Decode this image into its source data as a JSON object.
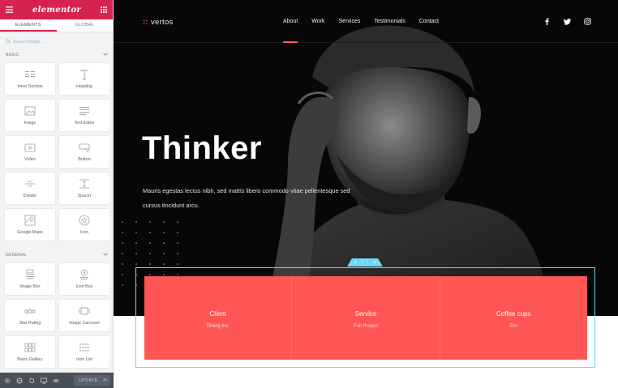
{
  "editor": {
    "logo": "elementor",
    "tabs": [
      {
        "label": "ELEMENTS"
      },
      {
        "label": "GLOBAL"
      }
    ],
    "search": {
      "placeholder": "Search Widget..."
    },
    "sections": [
      {
        "title": "BASIC",
        "widgets": [
          {
            "label": "Inner Section",
            "icon": "inner-section-icon"
          },
          {
            "label": "Heading",
            "icon": "heading-icon"
          },
          {
            "label": "Image",
            "icon": "image-icon"
          },
          {
            "label": "Text Editor",
            "icon": "text-editor-icon"
          },
          {
            "label": "Video",
            "icon": "video-icon"
          },
          {
            "label": "Button",
            "icon": "button-icon"
          },
          {
            "label": "Divider",
            "icon": "divider-icon"
          },
          {
            "label": "Spacer",
            "icon": "spacer-icon"
          },
          {
            "label": "Google Maps",
            "icon": "google-maps-icon"
          },
          {
            "label": "Icon",
            "icon": "star-icon"
          }
        ]
      },
      {
        "title": "GENERAL",
        "widgets": [
          {
            "label": "Image Box",
            "icon": "image-box-icon"
          },
          {
            "label": "Icon Box",
            "icon": "icon-box-icon"
          },
          {
            "label": "Star Rating",
            "icon": "star-rating-icon"
          },
          {
            "label": "Image Carousel",
            "icon": "image-carousel-icon"
          },
          {
            "label": "Basic Gallery",
            "icon": "basic-gallery-icon"
          },
          {
            "label": "Icon List",
            "icon": "icon-list-icon"
          }
        ]
      }
    ],
    "footer": {
      "update_label": "UPDATE"
    }
  },
  "site": {
    "brand": "vertos",
    "brand_mark": "::",
    "nav": [
      {
        "label": "About",
        "active": true
      },
      {
        "label": "Work"
      },
      {
        "label": "Services"
      },
      {
        "label": "Testimonials"
      },
      {
        "label": "Contact"
      }
    ],
    "social": [
      "facebook-icon",
      "twitter-icon",
      "instagram-icon"
    ],
    "hero": {
      "title": "Thinker",
      "subtitle": "Mauris egestas lectus nibh, sed mattis libero commodo vitae pellentesque sed cursus tincidunt arcu."
    },
    "stats": [
      {
        "label": "Client",
        "value": "Timing Inc."
      },
      {
        "label": "Service",
        "value": "Full Project"
      },
      {
        "label": "Coffee cups",
        "value": "50+"
      }
    ]
  },
  "colors": {
    "brand": "#d6224f",
    "accent": "#ff5555",
    "selection": "#71d7f7"
  }
}
